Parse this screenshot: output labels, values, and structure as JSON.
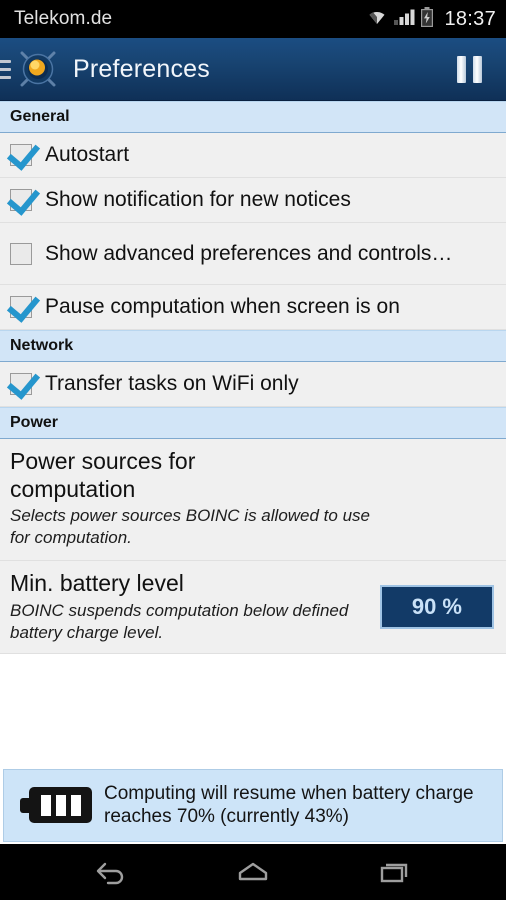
{
  "statusbar": {
    "carrier": "Telekom.de",
    "clock": "18:37",
    "icons": [
      "wifi-icon",
      "signal-icon",
      "battery-charging-icon"
    ]
  },
  "actionbar": {
    "title": "Preferences",
    "menu_icon": "hamburger-menu-icon",
    "app_icon": "boinc-logo-icon",
    "pause_label": "pause-icon",
    "bg_color": "#184472"
  },
  "sections": [
    {
      "header": "General",
      "rows": [
        {
          "type": "checkbox",
          "label": "Autostart",
          "checked": true
        },
        {
          "type": "checkbox",
          "label": "Show notification for new notices",
          "checked": true
        },
        {
          "type": "checkbox",
          "label": "Show advanced preferences and controls…",
          "checked": false
        },
        {
          "type": "checkbox",
          "label": "Pause computation when screen is on",
          "checked": true
        }
      ]
    },
    {
      "header": "Network",
      "rows": [
        {
          "type": "checkbox",
          "label": "Transfer tasks on WiFi only",
          "checked": true
        }
      ]
    },
    {
      "header": "Power",
      "rows": [
        {
          "type": "preference",
          "title": "Power sources for computation",
          "summary": "Selects power sources BOINC is allowed to use for computation."
        },
        {
          "type": "preference-value",
          "title": "Min. battery level",
          "summary": "BOINC suspends computation below defined battery charge level.",
          "value": "90 %",
          "value_bg": "#123a67",
          "value_border": "#9fc3e4",
          "value_text_color": "#c9e1f7"
        }
      ]
    }
  ],
  "notice": {
    "icon": "battery-icon",
    "text": "Computing will resume when battery charge reaches 70% (currently 43%)",
    "bg_color": "#cde4f8"
  },
  "navbar": {
    "back": "back-icon",
    "home": "home-icon",
    "recents": "recents-icon"
  }
}
